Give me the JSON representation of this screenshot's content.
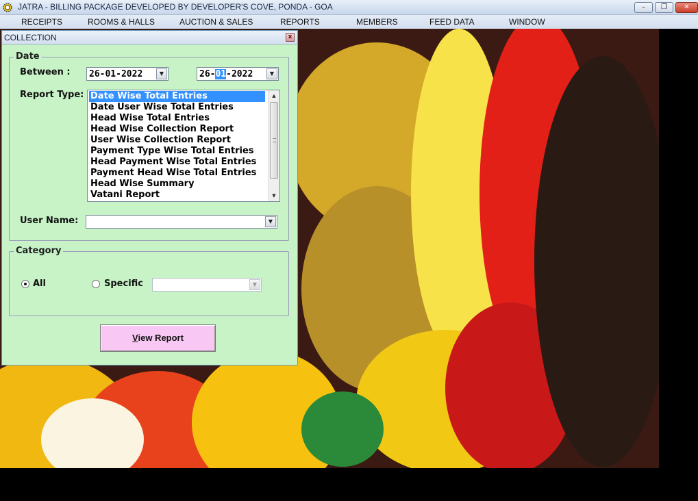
{
  "window": {
    "title": "JATRA - BILLING PACKAGE DEVELOPED BY DEVELOPER'S COVE, PONDA - GOA",
    "minimize_glyph": "–",
    "restore_glyph": "❐",
    "close_glyph": "✕"
  },
  "menu": {
    "items": [
      "RECEIPTS",
      "ROOMS & HALLS",
      "AUCTION & SALES",
      "REPORTS",
      "MEMBERS",
      "FEED DATA",
      "WINDOW"
    ]
  },
  "collection": {
    "title": "COLLECTION",
    "close_glyph": "x",
    "date_group": {
      "legend": "Date",
      "between_label": "Between :",
      "from_date": "26-01-2022",
      "to_date_prefix": "26-",
      "to_date_selected": "01",
      "to_date_suffix": "-2022"
    },
    "report_type_label": "Report Type:",
    "report_types": [
      "Date Wise Total Entries",
      "Date User Wise Total Entries",
      "Head Wise Total Entries",
      "Head Wise Collection Report",
      "User Wise Collection Report",
      "Payment Type Wise Total Entries",
      "Head Payment Wise Total Entries",
      "Payment Head Wise Total Entries",
      "Head Wise Summary",
      "Vatani Report"
    ],
    "selected_report_index": 0,
    "user_name_label": "User Name:",
    "user_name_value": "",
    "category_group": {
      "legend": "Category",
      "all_label": "All",
      "specific_label": "Specific",
      "selected": "All",
      "specific_value": ""
    },
    "view_report_first": "V",
    "view_report_rest": "iew Report"
  },
  "colors": {
    "panel_bg": "#c7f3c7",
    "button_bg": "#f8c7f3",
    "selection": "#3390ff"
  },
  "icons": {
    "app": "gear-sun-icon",
    "dropdown": "chevron-down-icon"
  }
}
